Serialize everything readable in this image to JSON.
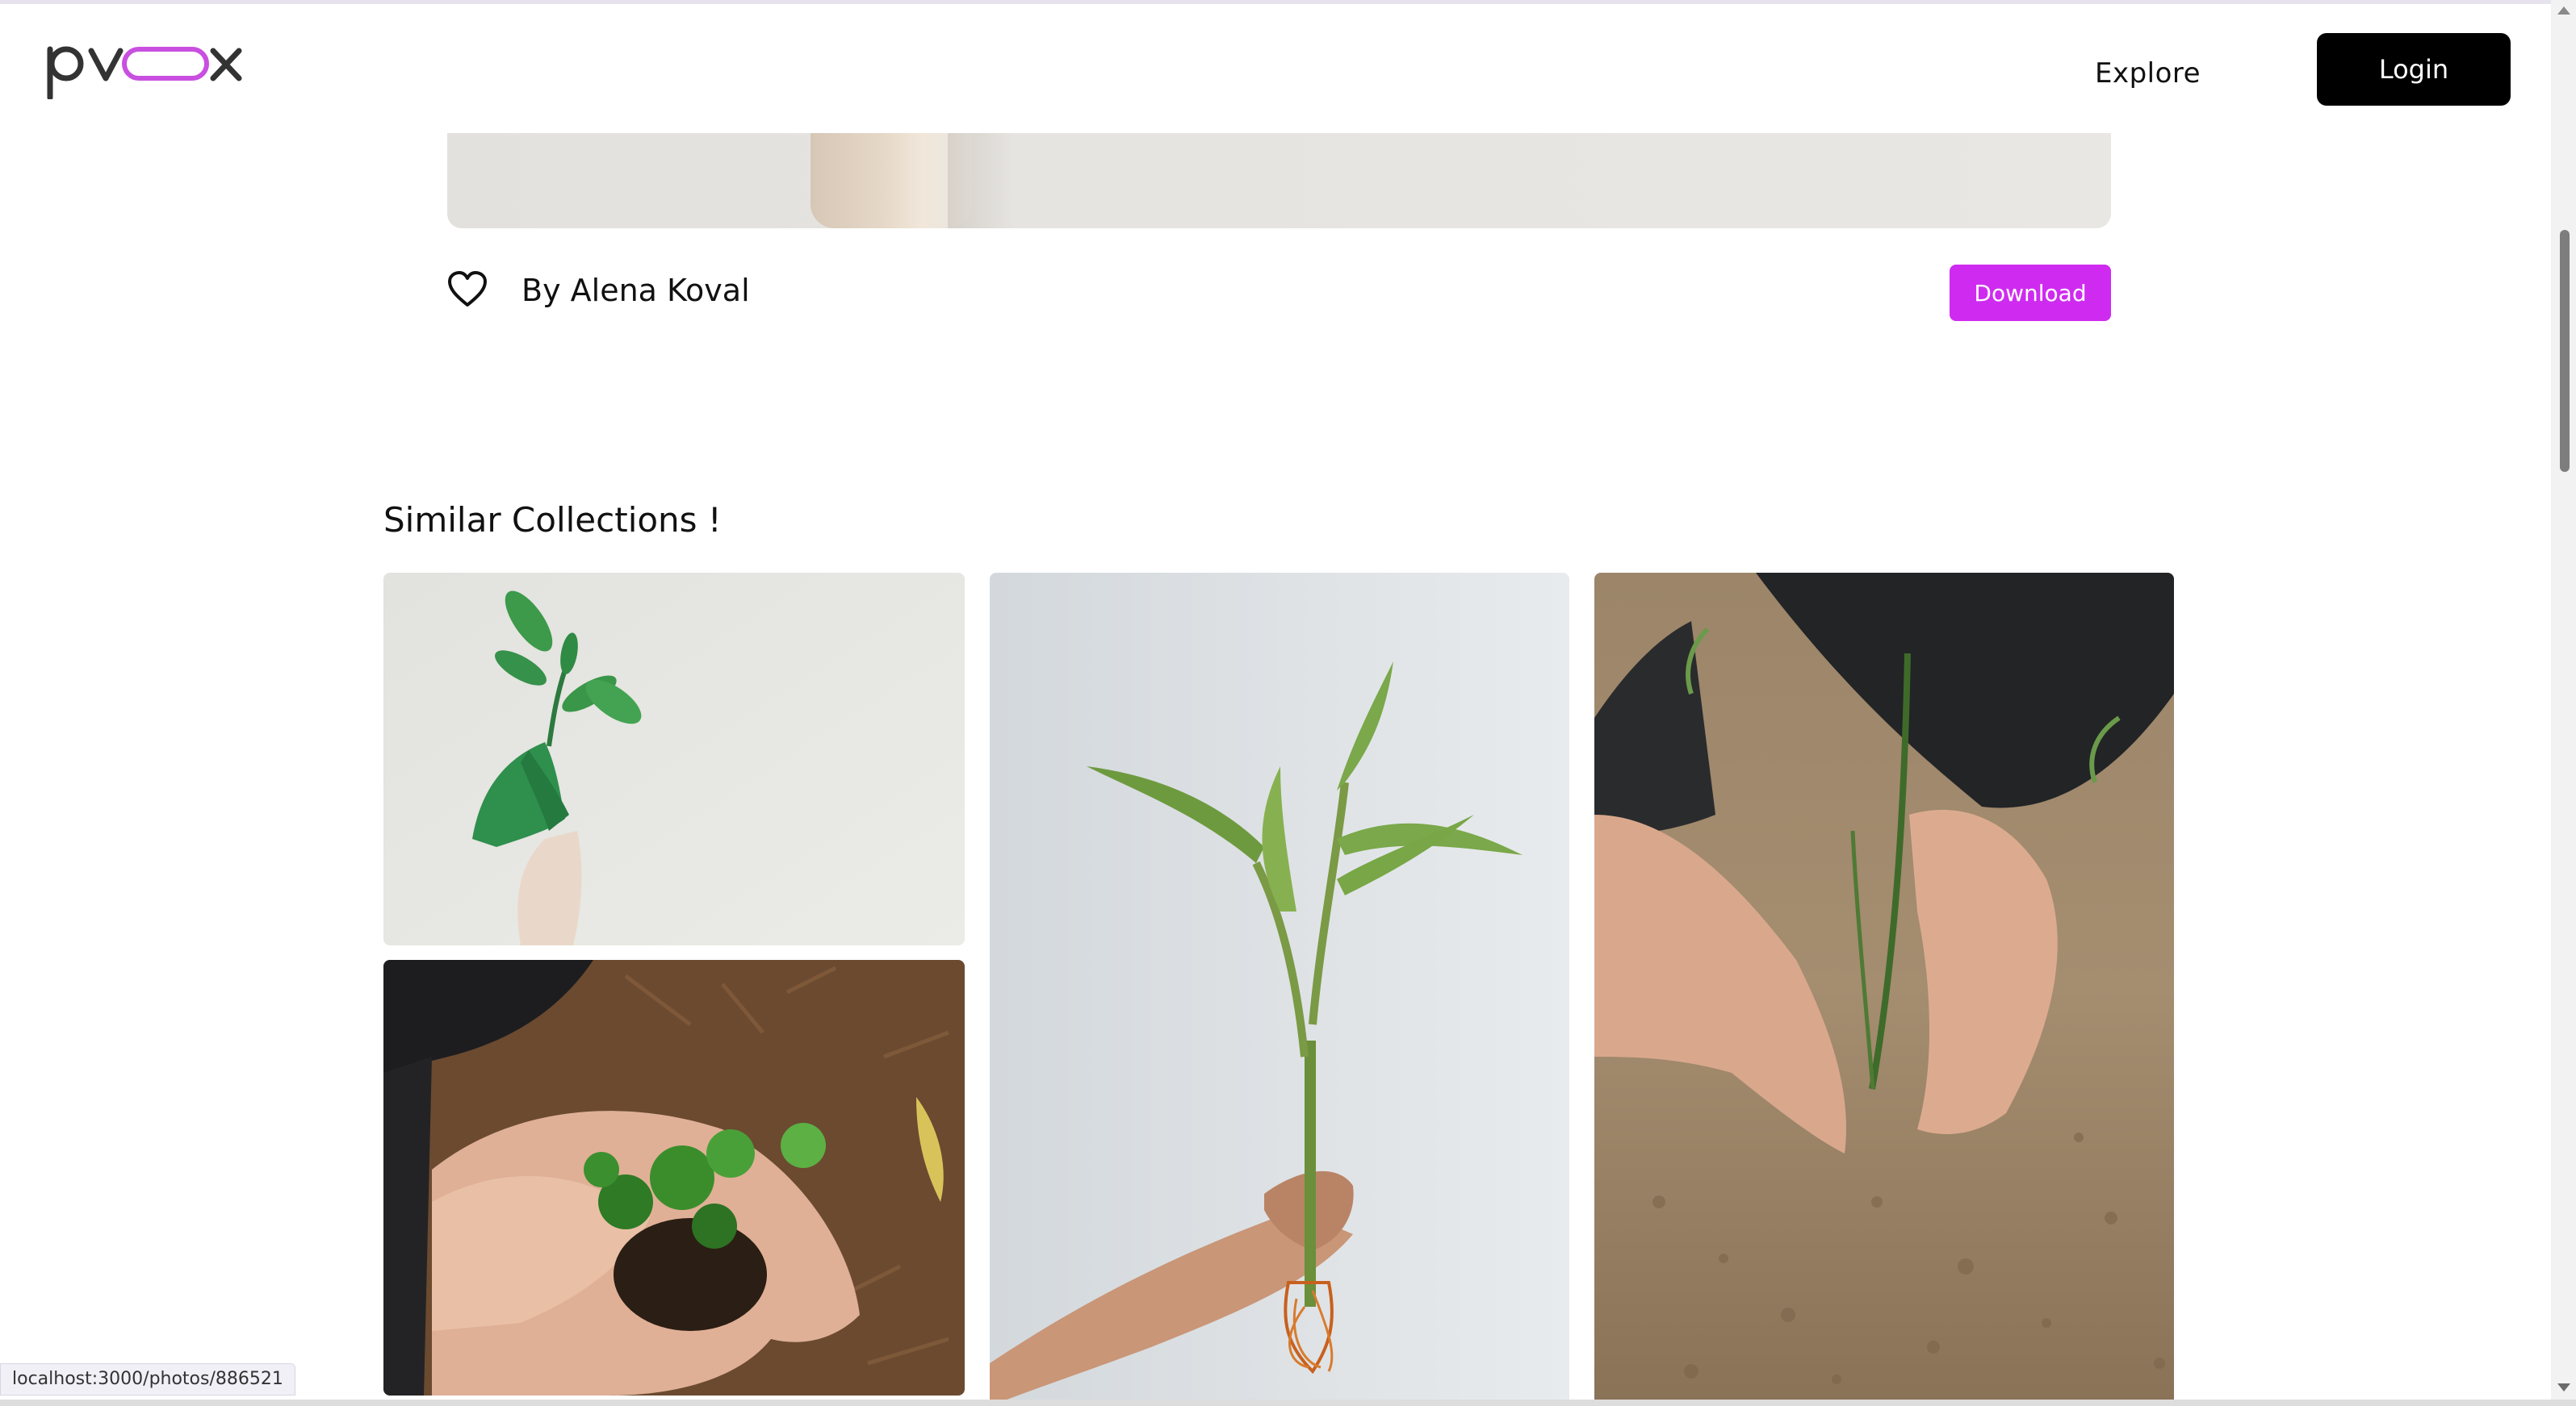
{
  "header": {
    "logo_text": "pvox",
    "nav": {
      "explore_label": "Explore",
      "login_label": "Login"
    }
  },
  "photo_detail": {
    "author_label": "By Alena Koval",
    "download_label": "Download",
    "icons": {
      "like": "heart-icon"
    }
  },
  "similar": {
    "title": "Similar Collections !",
    "photos": [
      {
        "description_icon": "photo-plant-green-hand"
      },
      {
        "description_icon": "photo-bamboo-stem-hand"
      },
      {
        "description_icon": "photo-planting-sprout-soil"
      },
      {
        "description_icon": "photo-seedling-cupped-hands"
      }
    ]
  },
  "status_bar": {
    "url": "localhost:3000/photos/886521"
  },
  "colors": {
    "accent": "#cf2bf0",
    "login_bg": "#000000",
    "logo_pill": "#c94fe0",
    "logo_text": "#333333"
  }
}
